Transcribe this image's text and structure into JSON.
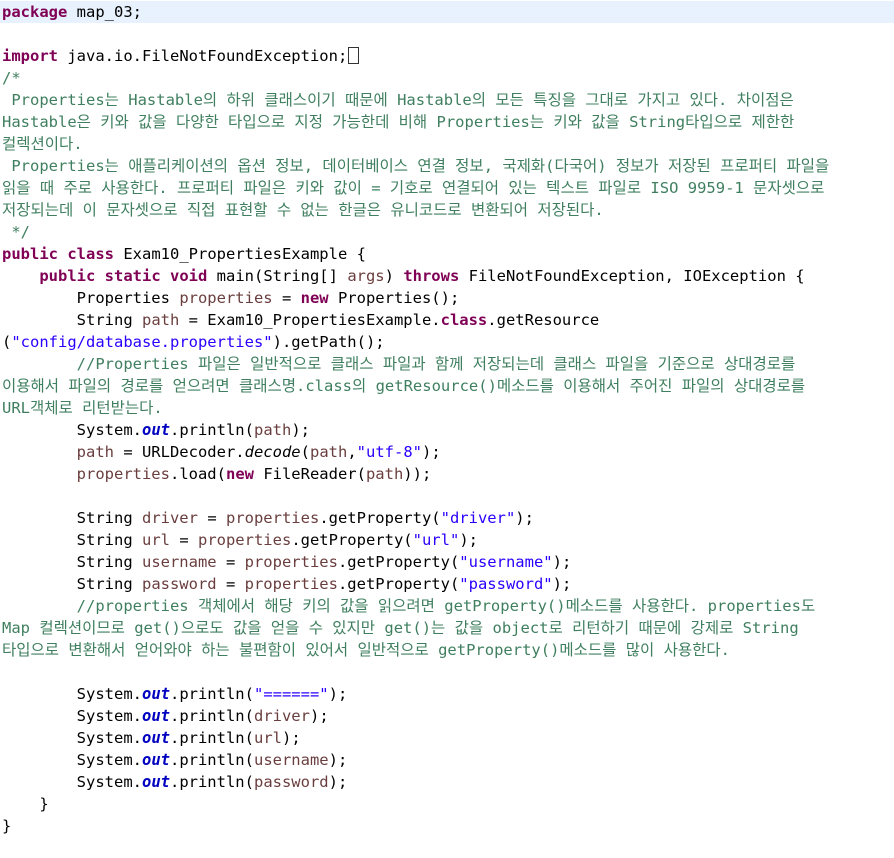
{
  "editor": {
    "package_line": {
      "keyword": "package",
      "name": " map_03;"
    },
    "import_line": {
      "keyword": "import",
      "name": " java.io.FileNotFoundException;"
    },
    "comment1": [
      "/*",
      " Properties는 Hastable의 하위 클래스이기 때문에 Hastable의 모든 특징을 그대로 가지고 있다. 차이점은",
      "Hastable은 키와 값을 다양한 타입으로 지정 가능한데 비해 Properties는 키와 값을 String타입으로 제한한",
      "컬렉션이다.",
      " Properties는 애플리케이션의 옵션 정보, 데이터베이스 연결 정보, 국제화(다국어) 정보가 저장된 프로퍼티 파일을",
      "읽을 때 주로 사용한다. 프로퍼티 파일은 키와 값이 = 기호로 연결되어 있는 텍스트 파일로 ISO 9959-1 문자셋으로",
      "저장되는데 이 문자셋으로 직접 표현할 수 없는 한글은 유니코드로 변환되어 저장된다.",
      " */"
    ],
    "class_decl": {
      "kw1": "public",
      "kw2": " class",
      "rest": " Exam10_PropertiesExample {"
    },
    "main_decl": {
      "indent": "    ",
      "kw1": "public",
      "kw2": " static",
      "kw3": " void",
      "mid": " main(String[] ",
      "args": "args",
      "mid2": ") ",
      "kw4": "throws",
      "rest": " FileNotFoundException, IOException {"
    },
    "props_decl": {
      "indent": "        ",
      "type": "Properties ",
      "var": "properties",
      "eq": " = ",
      "kw": "new",
      "rest": " Properties();"
    },
    "path_decl": {
      "indent": "        ",
      "pre": "String ",
      "var": "path",
      "mid": " = Exam10_PropertiesExample.",
      "kw": "class",
      "rest": ".getResource"
    },
    "path_decl2": {
      "open": "(",
      "str": "\"config/database.properties\"",
      "rest": ").getPath();"
    },
    "comment2": [
      "        //Properties 파일은 일반적으로 클래스 파일과 함께 저장되는데 클래스 파일을 기준으로 상대경로를",
      "이용해서 파일의 경로를 얻으려면 클래스명.class의 getResource()메소드를 이용해서 주어진 파일의 상대경로를",
      "URL객체로 리턴받는다."
    ],
    "println_path": {
      "indent": "        ",
      "pre": "System.",
      "fld": "out",
      "mid": ".println(",
      "var": "path",
      "rest": ");"
    },
    "decode_line": {
      "indent": "        ",
      "var": "path",
      "mid": " = URLDecoder.",
      "ital": "decode",
      "open": "(",
      "var2": "path",
      "comma": ",",
      "str": "\"utf-8\"",
      "rest": ");"
    },
    "load_line": {
      "indent": "        ",
      "var": "properties",
      "mid": ".load(",
      "kw": "new",
      "mid2": " FileReader(",
      "var2": "path",
      "rest": "));"
    },
    "get_lines": [
      {
        "pre": "        String ",
        "var": "driver",
        "mid": " = ",
        "obj": "properties",
        "call": ".getProperty(",
        "str": "\"driver\"",
        "rest": ");"
      },
      {
        "pre": "        String ",
        "var": "url",
        "mid": " = ",
        "obj": "properties",
        "call": ".getProperty(",
        "str": "\"url\"",
        "rest": ");"
      },
      {
        "pre": "        String ",
        "var": "username",
        "mid": " = ",
        "obj": "properties",
        "call": ".getProperty(",
        "str": "\"username\"",
        "rest": ");"
      },
      {
        "pre": "        String ",
        "var": "password",
        "mid": " = ",
        "obj": "properties",
        "call": ".getProperty(",
        "str": "\"password\"",
        "rest": ");"
      }
    ],
    "comment3": [
      "        //properties 객체에서 해당 키의 값을 읽으려면 getProperty()메소드를 사용한다. properties도",
      "Map 컬렉션이므로 get()으로도 값을 얻을 수 있지만 get()는 값을 object로 리턴하기 때문에 강제로 String",
      "타입으로 변환해서 얻어와야 하는 불편함이 있어서 일반적으로 getProperty()메소드를 많이 사용한다."
    ],
    "println_sep": {
      "indent": "        ",
      "pre": "System.",
      "fld": "out",
      "mid": ".println(",
      "str": "\"======\"",
      "rest": ");"
    },
    "println_vars": [
      {
        "indent": "        ",
        "pre": "System.",
        "fld": "out",
        "mid": ".println(",
        "var": "driver",
        "rest": ");"
      },
      {
        "indent": "        ",
        "pre": "System.",
        "fld": "out",
        "mid": ".println(",
        "var": "url",
        "rest": ");"
      },
      {
        "indent": "        ",
        "pre": "System.",
        "fld": "out",
        "mid": ".println(",
        "var": "username",
        "rest": ");"
      },
      {
        "indent": "        ",
        "pre": "System.",
        "fld": "out",
        "mid": ".println(",
        "var": "password",
        "rest": ");"
      }
    ],
    "close_method": "    }",
    "close_class": "}",
    "colors": {
      "keyword": "#7f0055",
      "comment": "#3f7f5f",
      "string": "#2a00ff",
      "field": "#0000c0",
      "local": "#6a3e3e",
      "highlight": "#e8f2fe"
    }
  }
}
